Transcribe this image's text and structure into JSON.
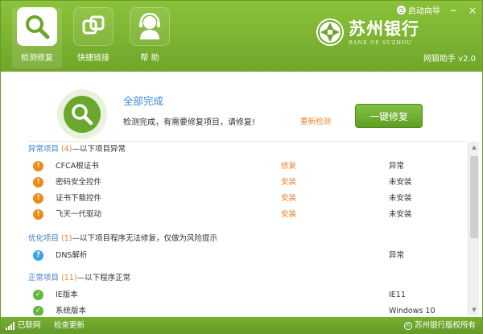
{
  "nav": {
    "items": [
      {
        "label": "检测修复",
        "icon": "magnifier-icon"
      },
      {
        "label": "快捷链接",
        "icon": "link-icon"
      },
      {
        "label": "帮 助",
        "icon": "support-agent-icon"
      }
    ]
  },
  "top": {
    "wizard_label": "启动向导",
    "minimize": "−",
    "close": "×"
  },
  "brand": {
    "cn": "苏州银行",
    "en": "BANK OF SUZHOU",
    "product": "网银助手 v2.0"
  },
  "status": {
    "title": "全部完成",
    "message": "检测完成，有需要修复项目，请修复!",
    "recheck": "重新检测",
    "repair_button": "一键修复"
  },
  "sections": {
    "abnormal": {
      "title": "异常项目",
      "count": "(4)",
      "desc": "—以下项目异常"
    },
    "optimize": {
      "title": "优化项目",
      "count": "(1)",
      "desc": "—以下项目程序无法修复，仅做为风险提示"
    },
    "normal": {
      "title": "正常项目",
      "count": "(11)",
      "desc": "—以下程序正常"
    }
  },
  "rows": {
    "abnormal": [
      {
        "name": "CFCA根证书",
        "action": "修复",
        "status": "异常"
      },
      {
        "name": "密码安全控件",
        "action": "安装",
        "status": "未安装"
      },
      {
        "name": "证书下载控件",
        "action": "安装",
        "status": "未安装"
      },
      {
        "name": "飞天一代驱动",
        "action": "安装",
        "status": "未安装"
      }
    ],
    "optimize": [
      {
        "name": "DNS解析",
        "action": "",
        "status": "异常"
      }
    ],
    "normal": [
      {
        "name": "IE版本",
        "action": "",
        "status": "IE11"
      },
      {
        "name": "系统版本",
        "action": "",
        "status": "Windows 10"
      }
    ]
  },
  "footer": {
    "network": "已联网",
    "update": "检查更新",
    "copyright": "苏州银行版权所有"
  },
  "colors": {
    "brand_green": "#70a62a",
    "accent_orange": "#e9822b",
    "title_blue": "#3b8ad9"
  }
}
